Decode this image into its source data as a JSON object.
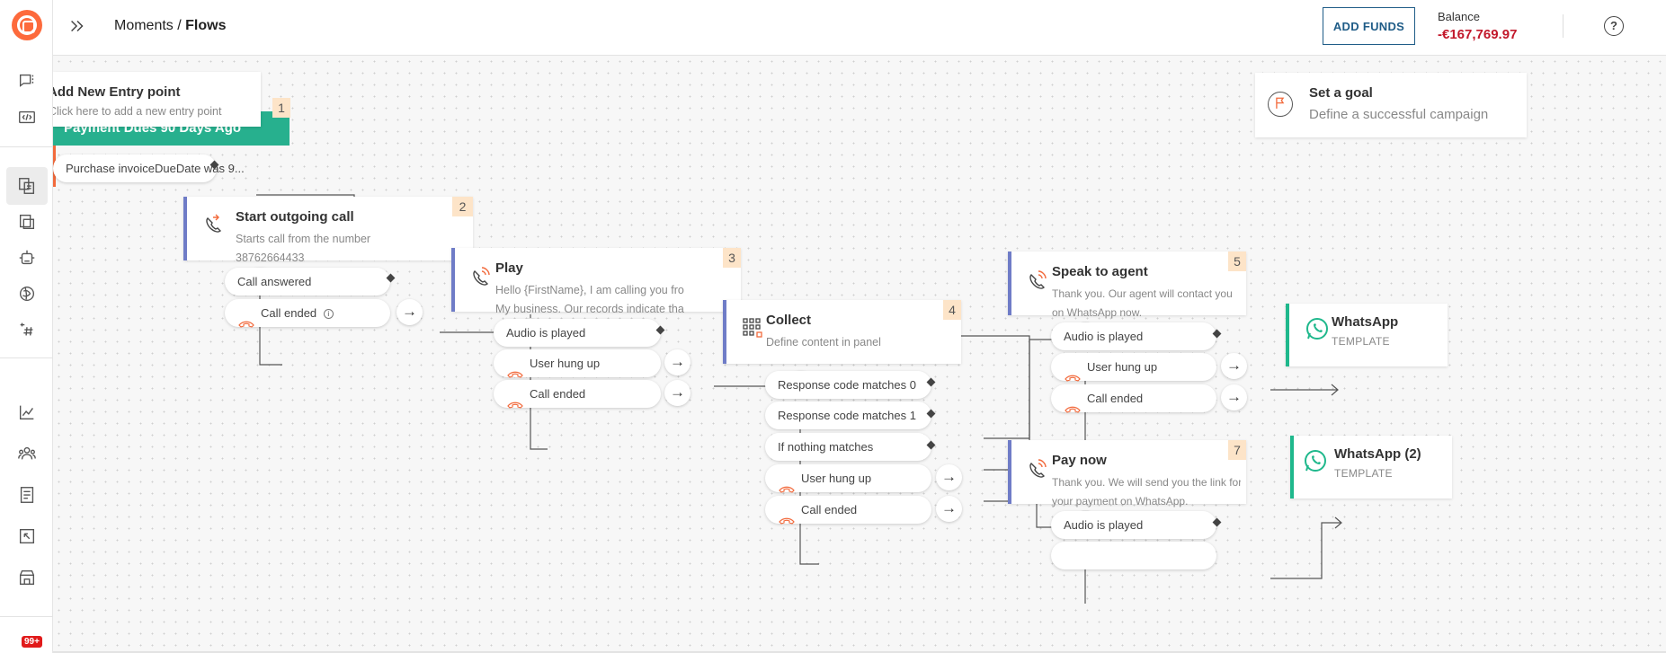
{
  "header": {
    "breadcrumb_section": "Moments",
    "breadcrumb_separator": " / ",
    "breadcrumb_page": "Flows",
    "add_funds_label": "ADD FUNDS",
    "balance_label": "Balance",
    "balance_value": "-€167,769.97",
    "help_label": "?"
  },
  "sidebar": {
    "badge": "99+",
    "icons": [
      "conversations-icon",
      "developer-icon",
      "flows-icon",
      "templates-icon",
      "bot-icon",
      "ai-icon",
      "hashtag-icon",
      "analytics-icon",
      "people-icon",
      "documents-icon",
      "exports-icon",
      "store-icon"
    ]
  },
  "entry": {
    "title": "Add New Entry point",
    "subtitle": "Click here to add a new entry point",
    "number": "1",
    "trigger_label": "Payment Dues 90 Days Ago",
    "condition": "Purchase invoiceDueDate was 9..."
  },
  "goal": {
    "title": "Set a goal",
    "subtitle": "Define a successful campaign"
  },
  "nodes": {
    "start_call": {
      "title": "Start outgoing call",
      "subtitle": "Starts call from the number",
      "number_value": "38762664433",
      "number": "2",
      "branches": [
        "Call answered",
        "Call ended"
      ]
    },
    "play": {
      "title": "Play",
      "line1": "Hello {FirstName}, I am calling you from",
      "line2": "My business. Our records indicate tha...",
      "number": "3",
      "branches": [
        "Audio is played",
        "User hung up",
        "Call ended"
      ]
    },
    "collect": {
      "title": "Collect",
      "subtitle": "Define content in panel",
      "number": "4",
      "branches": [
        "Response code matches 0",
        "Response code matches 1",
        "If nothing matches",
        "User hung up",
        "Call ended"
      ]
    },
    "speak_agent": {
      "title": "Speak to agent",
      "line1": "Thank you. Our agent will contact you",
      "line2": "on WhatsApp now.",
      "number": "5",
      "branches": [
        "Audio is played",
        "User hung up",
        "Call ended"
      ]
    },
    "pay_now": {
      "title": "Pay now",
      "line1": "Thank you. We will send you the link for",
      "line2": "your payment on WhatsApp.",
      "number": "7",
      "branches": [
        "Audio is played"
      ]
    },
    "whatsapp1": {
      "title": "WhatsApp",
      "subtitle": "TEMPLATE"
    },
    "whatsapp2": {
      "title": "WhatsApp (2)",
      "subtitle": "TEMPLATE"
    }
  },
  "colors": {
    "accent_orange": "#fd6a3c",
    "balance_red": "#c2182b",
    "voice_node": "#6f7cc7",
    "whatsapp_green": "#1fb88c",
    "entry_green": "#27b08e",
    "number_badge": "#fde4c8"
  }
}
